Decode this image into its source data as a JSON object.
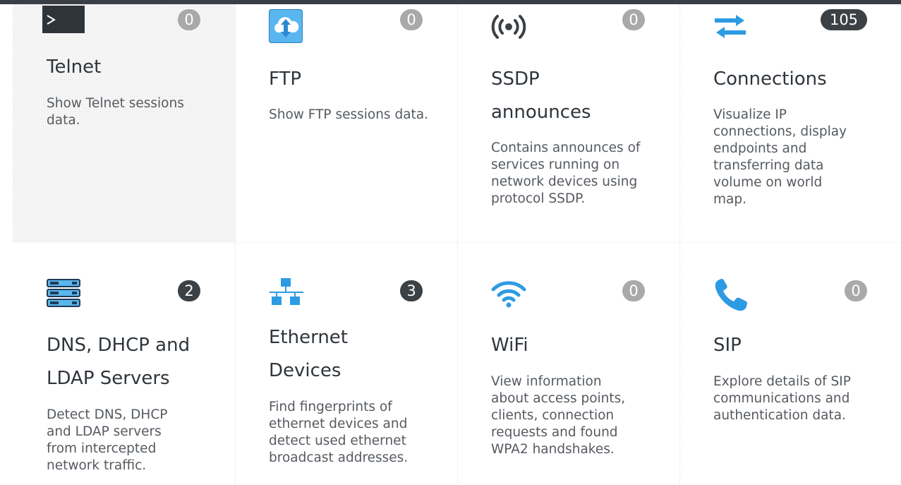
{
  "tiles": [
    {
      "title": "Telnet",
      "description": "Show Telnet sessions data.",
      "count": "0",
      "icon": "terminal-icon"
    },
    {
      "title": "FTP",
      "description": "Show FTP sessions data.",
      "count": "0",
      "icon": "cloud-transfer-icon"
    },
    {
      "title": "SSDP announces",
      "description": "Contains announces of services running on network devices using protocol SSDP.",
      "count": "0",
      "icon": "broadcast-icon"
    },
    {
      "title": "Connections",
      "description": "Visualize IP connections, display endpoints and transferring data volume on world map.",
      "count": "105",
      "icon": "transfer-arrows-icon"
    },
    {
      "title": "DNS, DHCP and LDAP Servers",
      "description": "Detect DNS, DHCP and LDAP servers from intercepted network traffic.",
      "count": "2",
      "icon": "server-rack-icon"
    },
    {
      "title": "Ethernet Devices",
      "description": "Find fingerprints of ethernet devices and detect used ethernet broadcast addresses.",
      "count": "3",
      "icon": "network-topology-icon"
    },
    {
      "title": "WiFi",
      "description": "View information about access points, clients, connection requests and found WPA2 handshakes.",
      "count": "0",
      "icon": "wifi-icon"
    },
    {
      "title": "SIP",
      "description": "Explore details of SIP communications and authentication data.",
      "count": "0",
      "icon": "phone-icon"
    }
  ],
  "colors": {
    "accent_blue": "#2d9be4",
    "badge_zero": "#a9a9a9",
    "badge_active": "#3c4146",
    "title_text": "#2f353b",
    "desc_text": "#555a60"
  }
}
